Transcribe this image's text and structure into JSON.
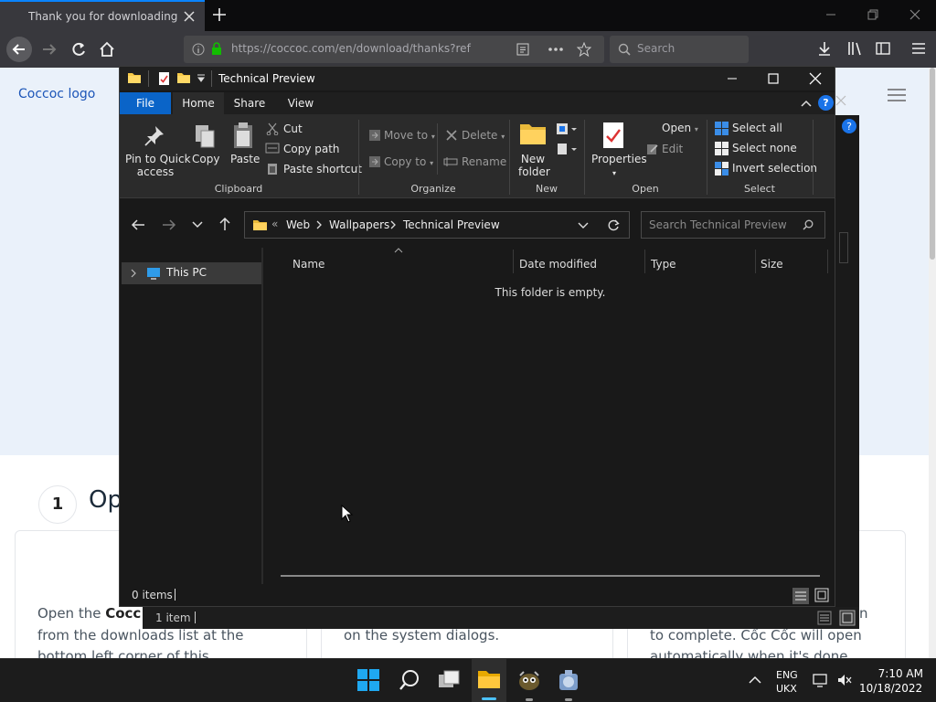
{
  "browser": {
    "tab_title": "Thank you for downloading Cốc Cốc",
    "url": "https://coccoc.com/en/download/thanks?ref",
    "search_placeholder": "Search"
  },
  "page": {
    "logo_alt": "Coccoc logo",
    "step_number": "1",
    "step_title": "Op",
    "col1_line1a": "Open the ",
    "col1_line1b": "Cocc",
    "col1_line2": "from the downloads list at the",
    "col1_line3": "bottom left corner of this",
    "col2_line2": "on the system dialogs.",
    "col3_line1": "n",
    "col3_line2": "to complete. Cốc Cốc will open",
    "col3_line3": "automatically when it's done",
    "behind_status": "1 item"
  },
  "explorer": {
    "title": "Technical Preview",
    "menu_tabs": [
      "File",
      "Home",
      "Share",
      "View"
    ],
    "help": "?",
    "clipboard": {
      "pin": "Pin to Quick access",
      "pin_line1": "Pin to Quick",
      "pin_line2": "access",
      "copy": "Copy",
      "paste": "Paste",
      "cut": "Cut",
      "copy_path": "Copy path",
      "paste_shortcut": "Paste shortcut",
      "group": "Clipboard"
    },
    "organize": {
      "move_to": "Move to",
      "copy_to": "Copy to",
      "delete": "Delete",
      "rename": "Rename",
      "group": "Organize"
    },
    "new": {
      "new_folder_line1": "New",
      "new_folder_line2": "folder",
      "group": "New"
    },
    "open": {
      "properties": "Properties",
      "open": "Open",
      "edit": "Edit",
      "group": "Open"
    },
    "select": {
      "select_all": "Select all",
      "select_none": "Select none",
      "invert": "Invert selection",
      "group": "Select"
    },
    "address": {
      "breadcrumb": [
        "Web",
        "Wallpapers",
        "Technical Preview"
      ],
      "overflow": "«"
    },
    "search_placeholder": "Search Technical Preview",
    "nav": {
      "this_pc": "This PC"
    },
    "columns": [
      "Name",
      "Date modified",
      "Type",
      "Size"
    ],
    "empty_message": "This folder is empty.",
    "status": "0 items"
  },
  "taskbar": {
    "lang_line1": "ENG",
    "lang_line2": "UKX",
    "time": "7:10 AM",
    "date": "10/18/2022"
  },
  "colors": {
    "accent": "#0078d4",
    "browser_accent": "#0a84ff",
    "explorer_bg": "#191919",
    "ribbon_bg": "#2b2b2b"
  }
}
